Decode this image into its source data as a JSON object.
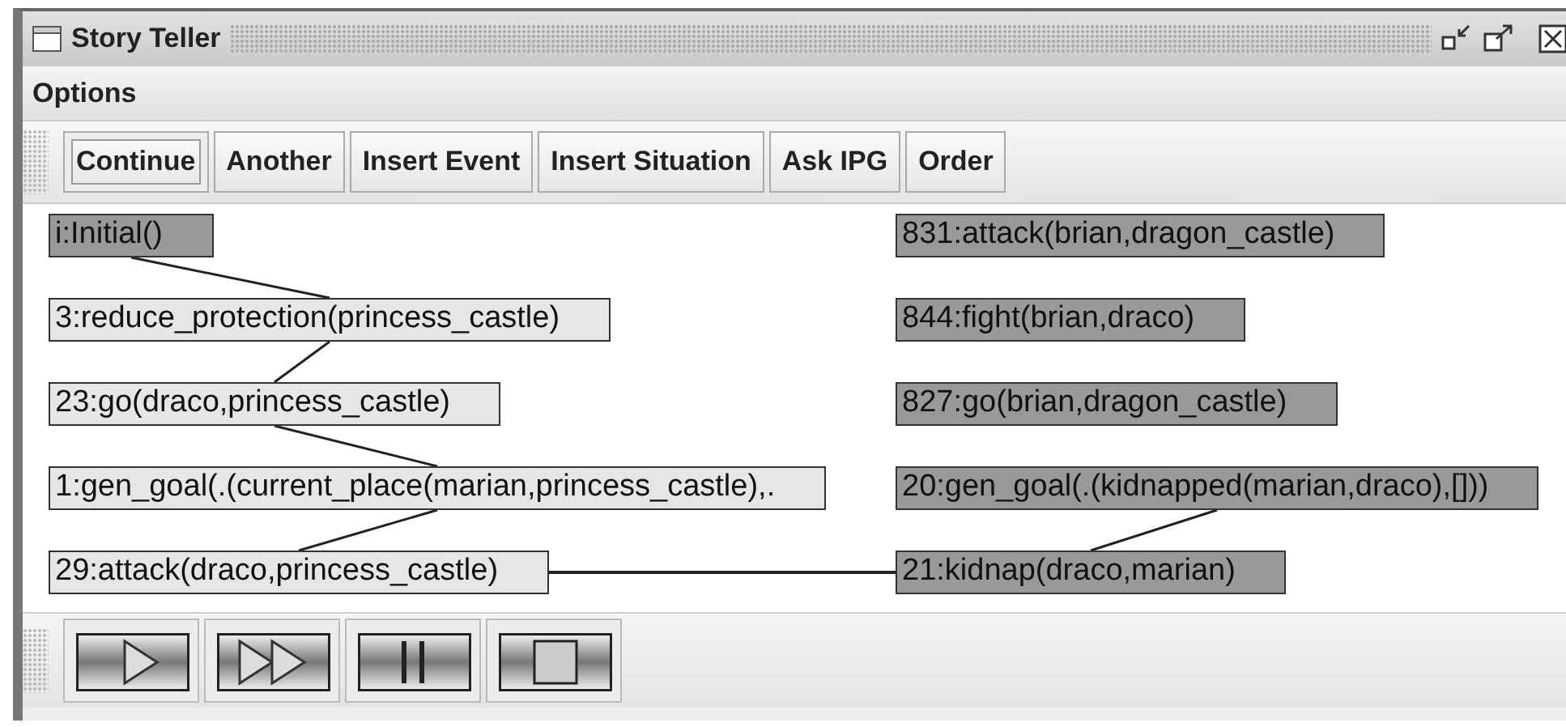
{
  "window": {
    "title": "Story Teller"
  },
  "menu": [
    "Options"
  ],
  "toolbar": [
    {
      "label": "Continue",
      "focused": true
    },
    {
      "label": "Another",
      "focused": false
    },
    {
      "label": "Insert Event",
      "focused": false
    },
    {
      "label": "Insert Situation",
      "focused": false
    },
    {
      "label": "Ask IPG",
      "focused": false
    },
    {
      "label": "Order",
      "focused": false
    }
  ],
  "graph": {
    "left_column": [
      {
        "label": "i:Initial()",
        "shaded": true,
        "linked_down": true
      },
      {
        "label": "3:reduce_protection(princess_castle)",
        "shaded": false,
        "linked_down": true
      },
      {
        "label": "23:go(draco,princess_castle)",
        "shaded": false,
        "linked_down": true
      },
      {
        "label": "1:gen_goal(.(current_place(marian,princess_castle),.",
        "shaded": false,
        "linked_down": true
      },
      {
        "label": "29:attack(draco,princess_castle)",
        "shaded": false,
        "linked_across": true
      }
    ],
    "right_column": [
      {
        "label": "831:attack(brian,dragon_castle)",
        "shaded": true
      },
      {
        "label": "844:fight(brian,draco)",
        "shaded": true
      },
      {
        "label": "827:go(brian,dragon_castle)",
        "shaded": true
      },
      {
        "label": "20:gen_goal(.(kidnapped(marian,draco),[]))",
        "shaded": true,
        "linked_down": true
      },
      {
        "label": "21:kidnap(draco,marian)",
        "shaded": true
      }
    ]
  },
  "playback_controls": [
    {
      "kind": "play"
    },
    {
      "kind": "fast_forward"
    },
    {
      "kind": "pause"
    },
    {
      "kind": "stop"
    }
  ]
}
